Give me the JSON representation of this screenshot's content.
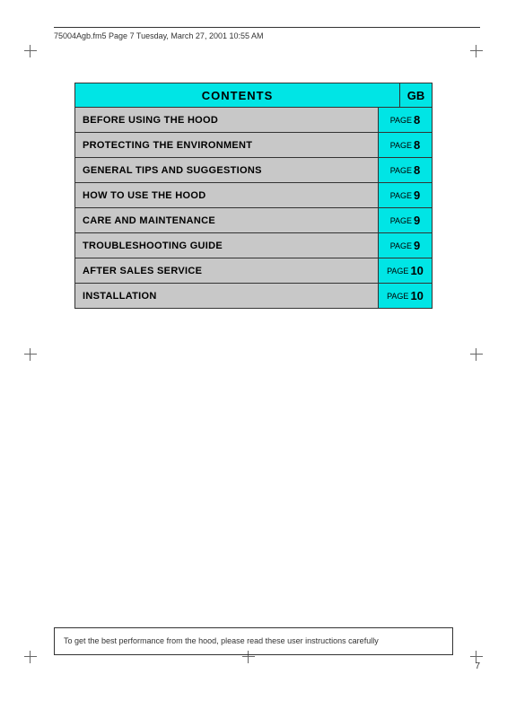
{
  "header": {
    "text": "75004Agb.fm5  Page 7  Tuesday, March 27, 2001  10:55 AM"
  },
  "contents": {
    "title": "CONTENTS",
    "gb_label": "GB",
    "rows": [
      {
        "label": "BEFORE USING THE HOOD",
        "page": "8"
      },
      {
        "label": "PROTECTING THE ENVIRONMENT",
        "page": "8"
      },
      {
        "label": "GENERAL TIPS AND SUGGESTIONS",
        "page": "8"
      },
      {
        "label": "HOW TO USE THE HOOD",
        "page": "9"
      },
      {
        "label": "CARE AND MAINTENANCE",
        "page": "9"
      },
      {
        "label": "TROUBLESHOOTING GUIDE",
        "page": "9"
      },
      {
        "label": "AFTER SALES SERVICE",
        "page": "10"
      },
      {
        "label": "INSTALLATION",
        "page": "10"
      }
    ],
    "page_word": "PAGE"
  },
  "footer": {
    "note": "To get the best performance from the hood, please read these user instructions carefully"
  },
  "page_number": "7"
}
